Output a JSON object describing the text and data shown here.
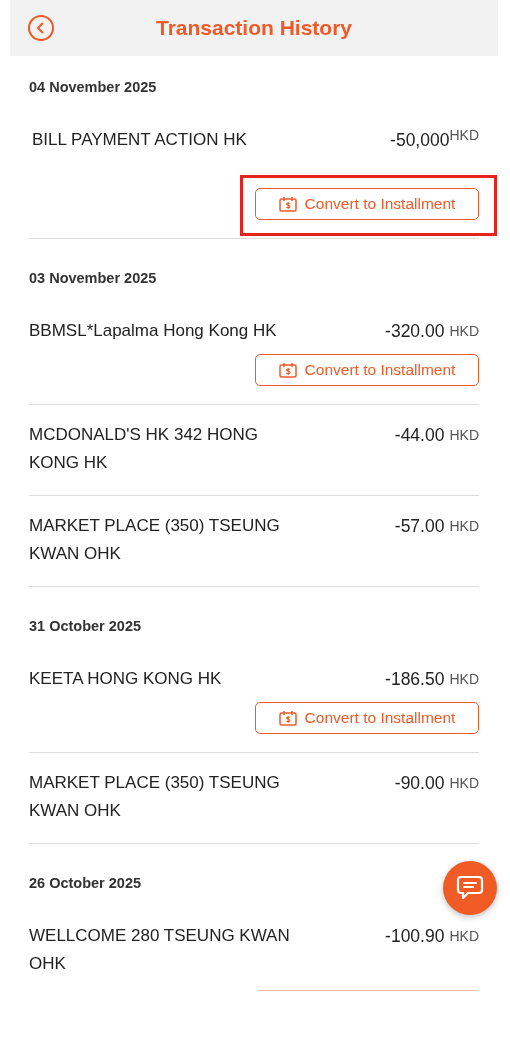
{
  "header": {
    "title": "Transaction History"
  },
  "groups": [
    {
      "date": "04 November 2025",
      "transactions": [
        {
          "merchant": "BILL PAYMENT ACTION HK",
          "amount": "-50,000",
          "currency": "HKD",
          "action": "Convert to Installment",
          "highlighted": true
        }
      ]
    },
    {
      "date": "03 November 2025",
      "transactions": [
        {
          "merchant": "BBMSL*Lapalma Hong Kong HK",
          "amount": "-320.00",
          "currency": "HKD",
          "action": "Convert to Installment"
        },
        {
          "merchant": "MCDONALD'S HK 342 HONG KONG HK",
          "amount": "-44.00",
          "currency": "HKD"
        },
        {
          "merchant": "MARKET PLACE (350) TSEUNG KWAN OHK",
          "amount": "-57.00",
          "currency": "HKD"
        }
      ]
    },
    {
      "date": "31 October 2025",
      "transactions": [
        {
          "merchant": "KEETA HONG KONG HK",
          "amount": "-186.50",
          "currency": "HKD",
          "action": "Convert to Installment"
        },
        {
          "merchant": "MARKET PLACE (350) TSEUNG KWAN OHK",
          "amount": "-90.00",
          "currency": "HKD"
        }
      ]
    },
    {
      "date": "26 October 2025",
      "transactions": [
        {
          "merchant": "WELLCOME 280 TSEUNG KWAN OHK",
          "amount": "-100.90",
          "currency": "HKD"
        }
      ]
    }
  ]
}
